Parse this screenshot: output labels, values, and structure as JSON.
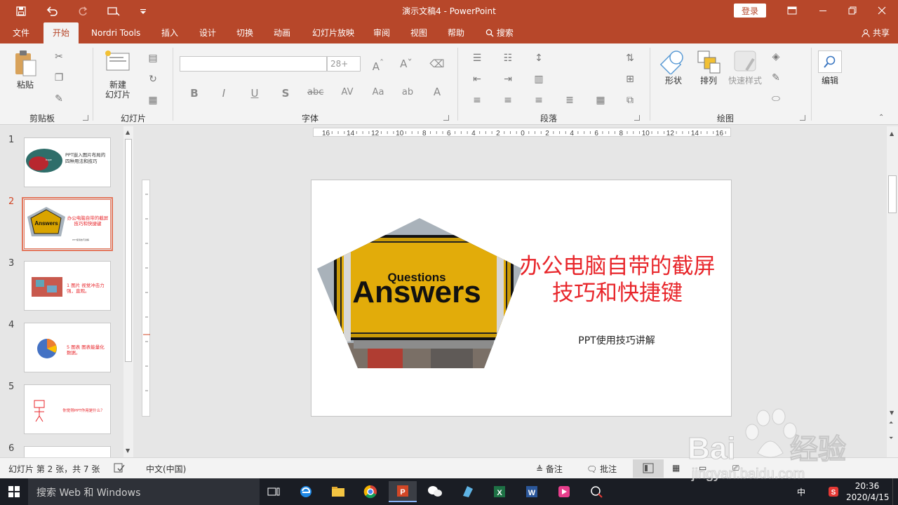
{
  "titlebar": {
    "doc_title": "演示文稿4  -  PowerPoint",
    "login": "登录",
    "qat_icons": [
      "save-icon",
      "undo-icon",
      "redo-icon",
      "touch-mode-icon",
      "customize-qat-icon"
    ],
    "window_icons": [
      "ribbon-display-icon",
      "minimize-icon",
      "restore-icon",
      "close-icon"
    ]
  },
  "tabs": {
    "items": [
      "文件",
      "开始",
      "Nordri Tools",
      "插入",
      "设计",
      "切换",
      "动画",
      "幻灯片放映",
      "审阅",
      "视图",
      "帮助"
    ],
    "active": "开始",
    "search": "搜索",
    "share": "共享"
  },
  "ribbon": {
    "clipboard": {
      "label": "剪贴板",
      "paste": "粘贴"
    },
    "slides": {
      "label": "幻灯片",
      "new_slide_line1": "新建",
      "new_slide_line2": "幻灯片"
    },
    "font": {
      "label": "字体",
      "font_name": "",
      "font_size": "28+"
    },
    "paragraph": {
      "label": "段落"
    },
    "drawing": {
      "label": "绘图",
      "shapes": "形状",
      "arrange": "排列",
      "quick_styles": "快速样式"
    },
    "editing": {
      "label": "编辑"
    }
  },
  "ruler": {
    "h_ticks": "16·14·12·10·8·6·4·2·0·2·4·6·8·10·12·14·16",
    "h_numbers": [
      "16",
      "14",
      "12",
      "10",
      "8",
      "6",
      "4",
      "2",
      "0",
      "2",
      "4",
      "6",
      "8",
      "10",
      "12",
      "14",
      "16"
    ]
  },
  "thumbnails": {
    "numbers": [
      "1",
      "2",
      "3",
      "4",
      "5",
      "6"
    ],
    "selected": "2",
    "thumb1_text": "PPT嵌入图片布局的四种用法和技巧",
    "thumb2_text": "办公电脑自带的截屏技巧和快捷键",
    "thumb3_text": "1  图片   视觉冲击力强，直观。",
    "thumb4_text": "5  图表   图表能量化数据。",
    "thumb5_text": "你觉得PPT作用是什么？"
  },
  "slide": {
    "title": "办公电脑自带的截屏技巧和快捷键",
    "subtitle": "PPT使用技巧讲解",
    "sign_small": "Questions",
    "sign_big": "Answers"
  },
  "status": {
    "slide_info": "幻灯片 第 2 张，共 7 张",
    "language": "中文(中国)",
    "notes": "备注",
    "comments": "批注"
  },
  "taskbar": {
    "search_placeholder": "搜索 Web 和 Windows",
    "time": "20:36",
    "date": "2020/4/15",
    "ime": "中"
  },
  "watermark": {
    "brand": "Bai",
    "brand2": "经验",
    "url": "jingyan.baidu.com"
  },
  "colors": {
    "accent": "#b7472a",
    "title_red": "#e8262b",
    "sign_yellow": "#d9a400"
  }
}
